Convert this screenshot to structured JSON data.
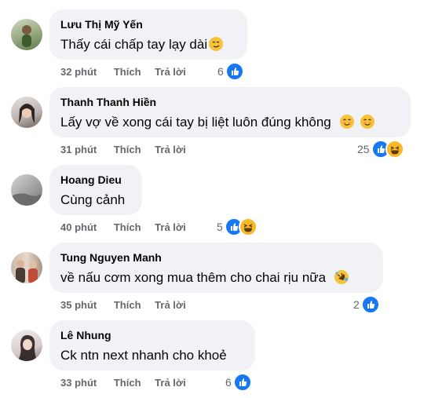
{
  "comments": [
    {
      "name": "Lưu Thị Mỹ Yến",
      "text": "Thấy cái chấp tay lạy dài",
      "emojis": [
        "smirk"
      ],
      "time": "32 phút",
      "like": "Thích",
      "reply": "Trả lời",
      "reactions": "6",
      "reaction_icons": [
        "like"
      ]
    },
    {
      "name": "Thanh Thanh Hiền",
      "text": "Lấy vợ về xong cái tay bị liệt luôn đúng không",
      "emojis": [
        "smile",
        "smile"
      ],
      "time": "31 phút",
      "like": "Thích",
      "reply": "Trả lời",
      "reactions": "25",
      "reaction_icons": [
        "like",
        "haha"
      ]
    },
    {
      "name": "Hoang Dieu",
      "text": "Cùng cảnh",
      "emojis": [],
      "time": "40 phút",
      "like": "Thích",
      "reply": "Trả lời",
      "reactions": "5",
      "reaction_icons": [
        "like",
        "haha"
      ]
    },
    {
      "name": "Tung Nguyen Manh",
      "text": "về nấu cơm xong mua thêm cho chai rịu nữa",
      "emojis": [
        "laugh-cry"
      ],
      "time": "35 phút",
      "like": "Thích",
      "reply": "Trả lời",
      "reactions": "2",
      "reaction_icons": [
        "like"
      ]
    },
    {
      "name": "Lê Nhung",
      "text": "Ck ntn next nhanh cho khoẻ",
      "emojis": [],
      "time": "33 phút",
      "like": "Thích",
      "reply": "Trả lời",
      "reactions": "6",
      "reaction_icons": [
        "like"
      ]
    }
  ],
  "colors": {
    "bubble": "#f0f2f5",
    "like_blue": "#1877f2",
    "haha_yellow": "#f7b928",
    "meta_gray": "#65676b"
  }
}
